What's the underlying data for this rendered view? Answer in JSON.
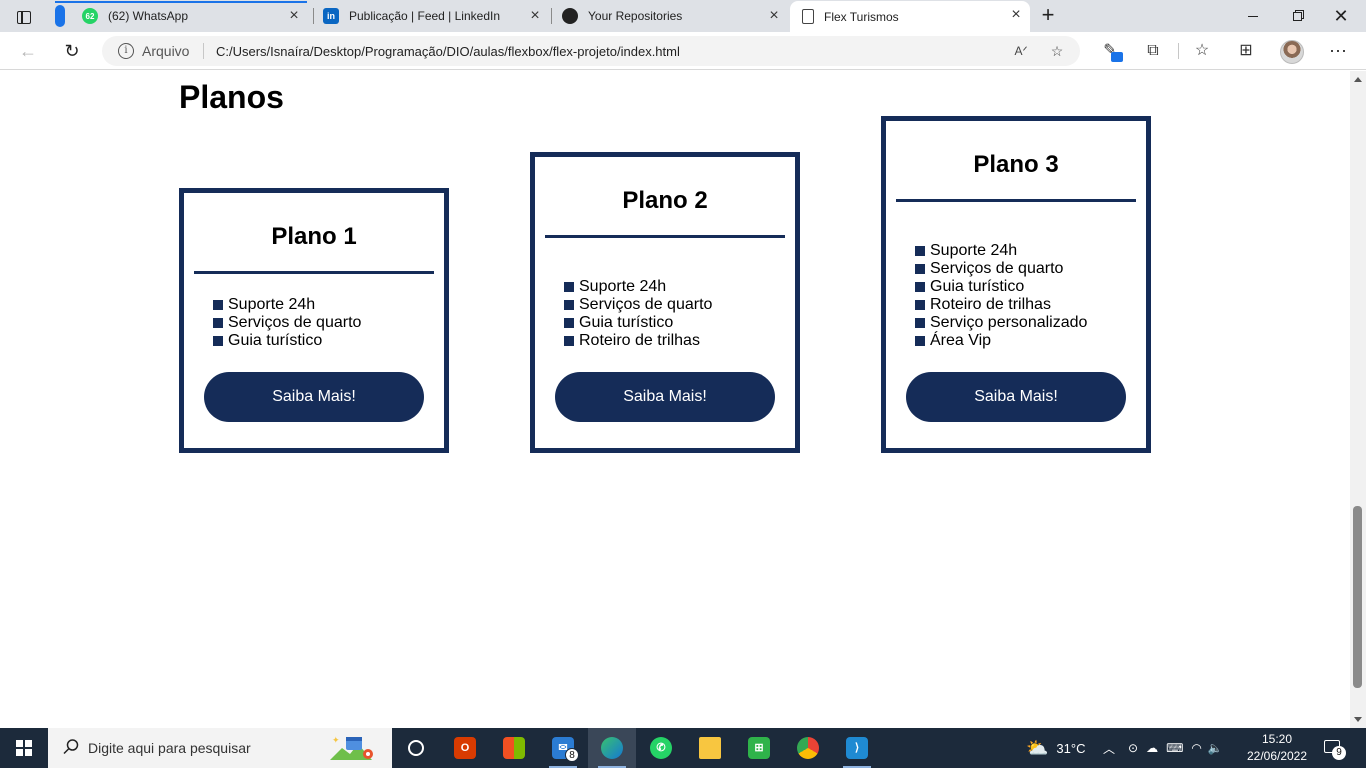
{
  "browser": {
    "tabs": [
      {
        "label": "(62) WhatsApp",
        "badge": "62",
        "icon": "whatsapp-icon",
        "active": false
      },
      {
        "label": "Publicação | Feed | LinkedIn",
        "icon": "linkedin-icon",
        "active": false
      },
      {
        "label": "Your Repositories",
        "icon": "github-icon",
        "active": false
      },
      {
        "label": "Flex Turismos",
        "icon": "page-icon",
        "active": true
      }
    ],
    "address": {
      "scheme_label": "Arquivo",
      "url": "C:/Users/Isnaíra/Desktop/Programação/DIO/aulas/flexbox/flex-projeto/index.html"
    }
  },
  "page": {
    "title": "Planos",
    "plans": [
      {
        "name": "Plano 1",
        "features": [
          "Suporte 24h",
          "Serviços de quarto",
          "Guia turístico"
        ],
        "cta": "Saiba Mais!"
      },
      {
        "name": "Plano 2",
        "features": [
          "Suporte 24h",
          "Serviços de quarto",
          "Guia turístico",
          "Roteiro de trilhas"
        ],
        "cta": "Saiba Mais!"
      },
      {
        "name": "Plano 3",
        "features": [
          "Suporte 24h",
          "Serviços de quarto",
          "Guia turístico",
          "Roteiro de trilhas",
          "Serviço personalizado",
          "Área Vip"
        ],
        "cta": "Saiba Mais!"
      }
    ],
    "colors": {
      "primary": "#152c58",
      "background": "#ffffff"
    }
  },
  "taskbar": {
    "search_placeholder": "Digite aqui para pesquisar",
    "apps": [
      {
        "name": "task-view-icon"
      },
      {
        "name": "office-icon"
      },
      {
        "name": "store-icon"
      },
      {
        "name": "mail-icon",
        "badge": "8"
      },
      {
        "name": "edge-icon"
      },
      {
        "name": "whatsapp-icon"
      },
      {
        "name": "file-explorer-icon"
      },
      {
        "name": "xbox-icon"
      },
      {
        "name": "chrome-icon"
      },
      {
        "name": "vscode-icon"
      }
    ],
    "weather": "31°C",
    "time": "15:20",
    "date": "22/06/2022",
    "notifications": "9"
  }
}
